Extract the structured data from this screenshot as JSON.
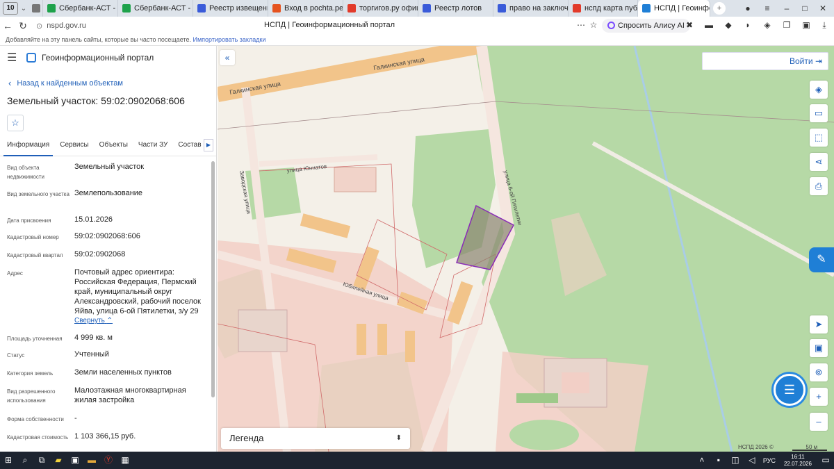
{
  "browser": {
    "tab_count": "10",
    "tabs": [
      {
        "label": "Сбербанк-АСТ - Эле",
        "color": "#1ea24b"
      },
      {
        "label": "Сбербанк-АСТ - Эле",
        "color": "#1ea24b"
      },
      {
        "label": "Реестр извещений",
        "color": "#3a5bd9"
      },
      {
        "label": "Вход в pochta.perm",
        "color": "#e5531f"
      },
      {
        "label": "торгигов.ру официа",
        "color": "#e23b2b"
      },
      {
        "label": "Реестр лотов",
        "color": "#3a5bd9"
      },
      {
        "label": "право на заключени",
        "color": "#3a5bd9"
      },
      {
        "label": "нспд карта публичн",
        "color": "#e23b2b"
      },
      {
        "label": "НСПД | Геоинфор",
        "color": "#1f7fd6"
      }
    ],
    "url": "nspd.gov.ru",
    "page_title": "НСПД | Геоинформационный портал",
    "alisa": "Спросить Алису AI",
    "bookmarks_text": "Добавляйте на эту панель сайты, которые вы часто посещаете.",
    "bookmarks_link": "Импортировать закладки"
  },
  "header": {
    "portal_name": "Геоинформационный портал"
  },
  "panel": {
    "back_link": "Назад к найденным объектам",
    "object_title": "Земельный участок: 59:02:0902068:606",
    "tabs": [
      "Информация",
      "Сервисы",
      "Объекты",
      "Части ЗУ",
      "Состав"
    ],
    "rows": [
      {
        "label": "Вид объекта недвижимости",
        "value": "Земельный участок"
      },
      {
        "label": "Вид земельного участка",
        "value": "Землепользование"
      },
      {
        "label": "Дата присвоения",
        "value": "15.01.2026"
      },
      {
        "label": "Кадастровый номер",
        "value": "59:02:0902068:606"
      },
      {
        "label": "Кадастровый квартал",
        "value": "59:02:0902068"
      },
      {
        "label": "Адрес",
        "value": "Почтовый адрес ориентира: Российская Федерация, Пермский край, муниципальный округ Александровский, рабочий поселок Яйва, улица 6-ой Пятилетки, з/у 29"
      },
      {
        "label": "Площадь уточненная",
        "value": "4 999 кв. м"
      },
      {
        "label": "Статус",
        "value": "Учтенный"
      },
      {
        "label": "Категория земель",
        "value": "Земли населенных пунктов"
      },
      {
        "label": "Вид разрешенного использования",
        "value": "Малоэтажная многоквартирная жилая застройка"
      },
      {
        "label": "Форма собственности",
        "value": "-"
      },
      {
        "label": "Кадастровая стоимость",
        "value": "1 103 366,15 руб."
      }
    ],
    "collapse_label": "Свернуть"
  },
  "map": {
    "login": "Войти",
    "legend": "Легенда",
    "streets": [
      "Галкинская улица",
      "улица Юннатов",
      "улица 6-ой Пятилетки",
      "Юбилейная улица",
      "Заводская улица"
    ],
    "attribution": "НСПД 2026 ©",
    "scale": "50 м",
    "selected_color": "#8a2bb8"
  },
  "taskbar": {
    "time": "16:11",
    "date": "22.07.2026",
    "lang": "РУС"
  }
}
